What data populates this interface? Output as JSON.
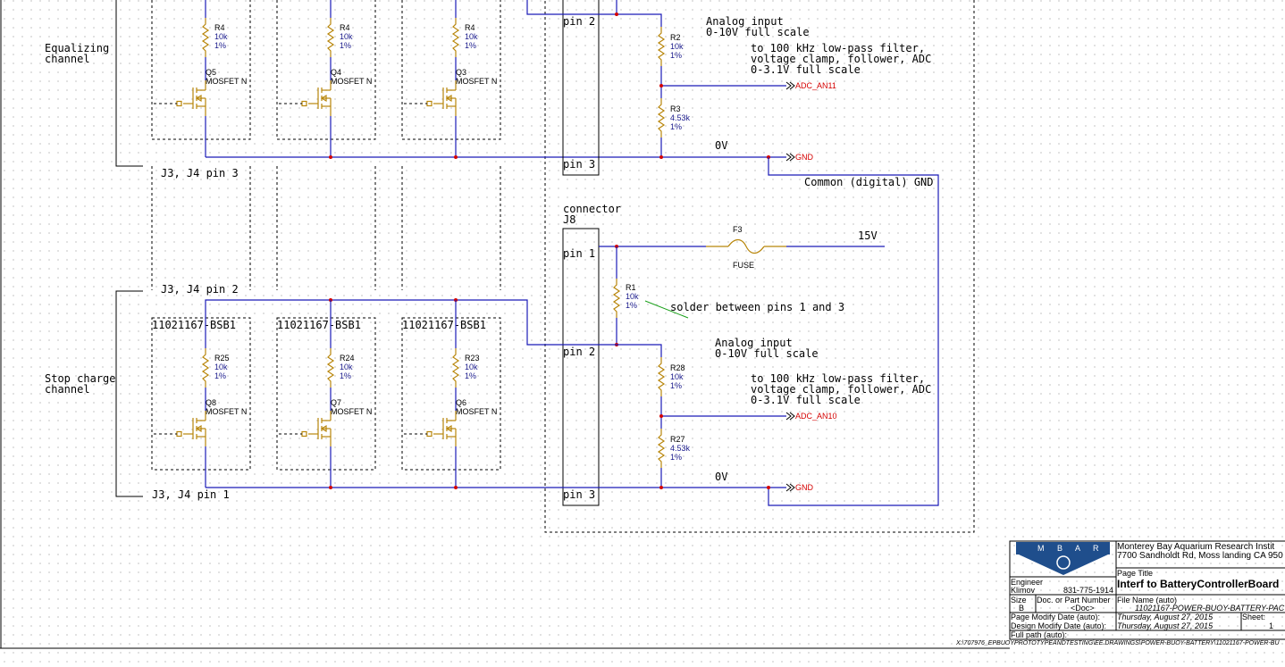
{
  "channels": {
    "equalizing": {
      "label_line1": "Equalizing",
      "label_line2": "channel",
      "top_pin": "J3, J4 pin 3"
    },
    "stop_charge": {
      "label_line1": "Stop charge",
      "label_line2": "channel",
      "top_pin": "J3, J4 pin 2",
      "bottom_pin": "J3, J4 pin 1"
    }
  },
  "upper_resistors": [
    {
      "ref": "R4",
      "value": "10k",
      "tol": "1%"
    },
    {
      "ref": "R4",
      "value": "10k",
      "tol": "1%"
    },
    {
      "ref": "R4",
      "value": "10k",
      "tol": "1%"
    }
  ],
  "upper_mosfets": [
    {
      "ref": "Q5",
      "type": "MOSFET N"
    },
    {
      "ref": "Q4",
      "type": "MOSFET N"
    },
    {
      "ref": "Q3",
      "type": "MOSFET N"
    }
  ],
  "lower_blocks": [
    "11021167-BSB1",
    "11021167-BSB1",
    "11021167-BSB1"
  ],
  "lower_resistors": [
    {
      "ref": "R25",
      "value": "10k",
      "tol": "1%"
    },
    {
      "ref": "R24",
      "value": "10k",
      "tol": "1%"
    },
    {
      "ref": "R23",
      "value": "10k",
      "tol": "1%"
    }
  ],
  "lower_mosfets": [
    {
      "ref": "Q8",
      "type": "MOSFET N"
    },
    {
      "ref": "Q7",
      "type": "MOSFET N"
    },
    {
      "ref": "Q6",
      "type": "MOSFET N"
    }
  ],
  "upper_connector": {
    "pin2": "pin 2",
    "pin3": "pin 3"
  },
  "lower_connector": {
    "title": "connector",
    "ref": "J8",
    "pin1": "pin 1",
    "pin2": "pin 2",
    "pin3": "pin 3"
  },
  "upper_analog": {
    "line1": "Analog input",
    "line2": "0-10V full scale",
    "note1": "to 100 kHz low-pass filter,",
    "note2": "voltage clamp, follower, ADC",
    "note3": "0-3.1V full scale",
    "r2": {
      "ref": "R2",
      "value": "10k",
      "tol": "1%"
    },
    "r3": {
      "ref": "R3",
      "value": "4.53k",
      "tol": "1%"
    },
    "adc_port": "ADC_AN11",
    "zero_v": "0V",
    "gnd_port": "GND"
  },
  "lower_analog": {
    "line1": "Analog input",
    "line2": "0-10V full scale",
    "note1": "to 100 kHz low-pass filter,",
    "note2": "voltage clamp, follower, ADC",
    "note3": "0-3.1V full scale",
    "r28": {
      "ref": "R28",
      "value": "10k",
      "tol": "1%"
    },
    "r27": {
      "ref": "R27",
      "value": "4.53k",
      "tol": "1%"
    },
    "adc_port": "ADC_AN10",
    "zero_v": "0V",
    "gnd_port": "GND"
  },
  "common_gnd": "Common (digital) GND",
  "fuse": {
    "ref": "F3",
    "label": "FUSE",
    "supply": "15V"
  },
  "r1": {
    "ref": "R1",
    "value": "10k",
    "tol": "1%",
    "note": "solder between pins 1 and 3"
  },
  "title_block": {
    "org_line1": "Monterey Bay Aquarium Research Instit",
    "org_line2": "7700 Sandholdt Rd, Moss landing CA 950",
    "logo_text": "M B A R I",
    "page_title_label": "Page Title",
    "page_title": "Interf to BatteryControllerBoard",
    "engineer_label": "Engineer",
    "engineer": "Klimov",
    "phone": "831-775-1914",
    "size_label": "Size",
    "size": "B",
    "doc_label": "Doc. or Part Number",
    "doc": "<Doc>",
    "filename_label": "File Name (auto)",
    "filename": "11021167-POWER-BUOY-BATTERY-PAC",
    "page_mod_label": "Page  Modify Date (auto):",
    "page_mod": "Thursday, August 27, 2015",
    "design_mod_label": "Design Modify Date (auto):",
    "design_mod": "Thursday, August 27, 2015",
    "sheet_label": "Sheet:",
    "sheet": "1",
    "fullpath_label": "Full path (auto):",
    "fullpath": "X:\\707976_EPBUOYPROTOTYPEANDTESTING\\EE.DRAWINGS\\POWER-BUOY-BATTERY\\11021167-POWER-BU"
  },
  "colors": {
    "wire": "#1b1bb8",
    "component": "#b8860b",
    "junction": "#d40000",
    "port_text": "#d40000",
    "logo_bg": "#1f4e8c"
  }
}
